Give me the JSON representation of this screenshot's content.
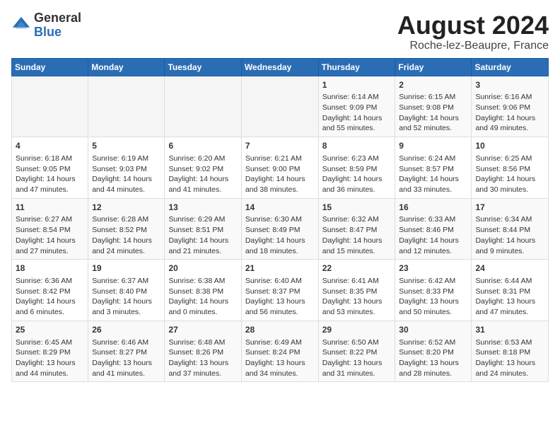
{
  "header": {
    "logo_general": "General",
    "logo_blue": "Blue",
    "month_year": "August 2024",
    "location": "Roche-lez-Beaupre, France"
  },
  "days_of_week": [
    "Sunday",
    "Monday",
    "Tuesday",
    "Wednesday",
    "Thursday",
    "Friday",
    "Saturday"
  ],
  "weeks": [
    [
      {
        "day": "",
        "details": ""
      },
      {
        "day": "",
        "details": ""
      },
      {
        "day": "",
        "details": ""
      },
      {
        "day": "",
        "details": ""
      },
      {
        "day": "1",
        "details": "Sunrise: 6:14 AM\nSunset: 9:09 PM\nDaylight: 14 hours and 55 minutes."
      },
      {
        "day": "2",
        "details": "Sunrise: 6:15 AM\nSunset: 9:08 PM\nDaylight: 14 hours and 52 minutes."
      },
      {
        "day": "3",
        "details": "Sunrise: 6:16 AM\nSunset: 9:06 PM\nDaylight: 14 hours and 49 minutes."
      }
    ],
    [
      {
        "day": "4",
        "details": "Sunrise: 6:18 AM\nSunset: 9:05 PM\nDaylight: 14 hours and 47 minutes."
      },
      {
        "day": "5",
        "details": "Sunrise: 6:19 AM\nSunset: 9:03 PM\nDaylight: 14 hours and 44 minutes."
      },
      {
        "day": "6",
        "details": "Sunrise: 6:20 AM\nSunset: 9:02 PM\nDaylight: 14 hours and 41 minutes."
      },
      {
        "day": "7",
        "details": "Sunrise: 6:21 AM\nSunset: 9:00 PM\nDaylight: 14 hours and 38 minutes."
      },
      {
        "day": "8",
        "details": "Sunrise: 6:23 AM\nSunset: 8:59 PM\nDaylight: 14 hours and 36 minutes."
      },
      {
        "day": "9",
        "details": "Sunrise: 6:24 AM\nSunset: 8:57 PM\nDaylight: 14 hours and 33 minutes."
      },
      {
        "day": "10",
        "details": "Sunrise: 6:25 AM\nSunset: 8:56 PM\nDaylight: 14 hours and 30 minutes."
      }
    ],
    [
      {
        "day": "11",
        "details": "Sunrise: 6:27 AM\nSunset: 8:54 PM\nDaylight: 14 hours and 27 minutes."
      },
      {
        "day": "12",
        "details": "Sunrise: 6:28 AM\nSunset: 8:52 PM\nDaylight: 14 hours and 24 minutes."
      },
      {
        "day": "13",
        "details": "Sunrise: 6:29 AM\nSunset: 8:51 PM\nDaylight: 14 hours and 21 minutes."
      },
      {
        "day": "14",
        "details": "Sunrise: 6:30 AM\nSunset: 8:49 PM\nDaylight: 14 hours and 18 minutes."
      },
      {
        "day": "15",
        "details": "Sunrise: 6:32 AM\nSunset: 8:47 PM\nDaylight: 14 hours and 15 minutes."
      },
      {
        "day": "16",
        "details": "Sunrise: 6:33 AM\nSunset: 8:46 PM\nDaylight: 14 hours and 12 minutes."
      },
      {
        "day": "17",
        "details": "Sunrise: 6:34 AM\nSunset: 8:44 PM\nDaylight: 14 hours and 9 minutes."
      }
    ],
    [
      {
        "day": "18",
        "details": "Sunrise: 6:36 AM\nSunset: 8:42 PM\nDaylight: 14 hours and 6 minutes."
      },
      {
        "day": "19",
        "details": "Sunrise: 6:37 AM\nSunset: 8:40 PM\nDaylight: 14 hours and 3 minutes."
      },
      {
        "day": "20",
        "details": "Sunrise: 6:38 AM\nSunset: 8:38 PM\nDaylight: 14 hours and 0 minutes."
      },
      {
        "day": "21",
        "details": "Sunrise: 6:40 AM\nSunset: 8:37 PM\nDaylight: 13 hours and 56 minutes."
      },
      {
        "day": "22",
        "details": "Sunrise: 6:41 AM\nSunset: 8:35 PM\nDaylight: 13 hours and 53 minutes."
      },
      {
        "day": "23",
        "details": "Sunrise: 6:42 AM\nSunset: 8:33 PM\nDaylight: 13 hours and 50 minutes."
      },
      {
        "day": "24",
        "details": "Sunrise: 6:44 AM\nSunset: 8:31 PM\nDaylight: 13 hours and 47 minutes."
      }
    ],
    [
      {
        "day": "25",
        "details": "Sunrise: 6:45 AM\nSunset: 8:29 PM\nDaylight: 13 hours and 44 minutes."
      },
      {
        "day": "26",
        "details": "Sunrise: 6:46 AM\nSunset: 8:27 PM\nDaylight: 13 hours and 41 minutes."
      },
      {
        "day": "27",
        "details": "Sunrise: 6:48 AM\nSunset: 8:26 PM\nDaylight: 13 hours and 37 minutes."
      },
      {
        "day": "28",
        "details": "Sunrise: 6:49 AM\nSunset: 8:24 PM\nDaylight: 13 hours and 34 minutes."
      },
      {
        "day": "29",
        "details": "Sunrise: 6:50 AM\nSunset: 8:22 PM\nDaylight: 13 hours and 31 minutes."
      },
      {
        "day": "30",
        "details": "Sunrise: 6:52 AM\nSunset: 8:20 PM\nDaylight: 13 hours and 28 minutes."
      },
      {
        "day": "31",
        "details": "Sunrise: 6:53 AM\nSunset: 8:18 PM\nDaylight: 13 hours and 24 minutes."
      }
    ]
  ]
}
